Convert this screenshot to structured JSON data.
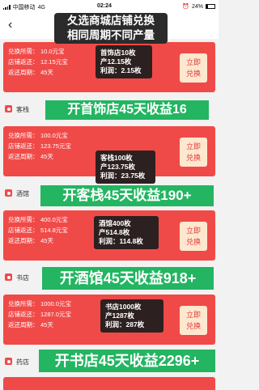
{
  "status": {
    "carrier": "中国移动",
    "network": "4G",
    "time": "02:24",
    "battery": "24%"
  },
  "header": {
    "back": "‹",
    "overlay_line1": "夂选商城店铺兑换",
    "overlay_line2": "相同周期不同产量"
  },
  "labels": {
    "price": "兑换所需：",
    "return": "店铺返还：",
    "cycle": "返还周期：",
    "redeem1": "立即",
    "redeem2": "兑换"
  },
  "cards": [
    {
      "price": "10.0元宝",
      "return": "12.15元宝",
      "cycle": "45天",
      "summary": [
        "首饰店10枚",
        "产12.15枚",
        "利润：2.15枚"
      ]
    },
    {
      "price": "100.0元宝",
      "return": "123.75元宝",
      "cycle": "45天",
      "summary": [
        "客栈100枚",
        "产123.75枚",
        "利润：23.75枚"
      ]
    },
    {
      "price": "400.0元宝",
      "return": "514.8元宝",
      "cycle": "45天",
      "summary": [
        "酒馆400枚",
        "产514.8枚",
        "利润：114.8枚"
      ]
    },
    {
      "price": "1000.0元宝",
      "return": "1287.0元宝",
      "cycle": "45天",
      "summary": [
        "书店1000枚",
        "产1287枚",
        "利润：287枚"
      ]
    }
  ],
  "shops": [
    {
      "name": "客栈"
    },
    {
      "name": "酒馆"
    },
    {
      "name": "书店"
    },
    {
      "name": "药店"
    }
  ],
  "banners": [
    {
      "text": "开首饰店45天收益16"
    },
    {
      "text": "开客栈45天收益190+"
    },
    {
      "text": "开酒馆45天收益918+"
    },
    {
      "text": "开书店45天收益2296+"
    }
  ],
  "colors": {
    "card_red": "#f04a48",
    "banner_green": "#23b561",
    "redeem_bg": "#fde8cf",
    "overlay_dark": "#2b2b2b"
  }
}
